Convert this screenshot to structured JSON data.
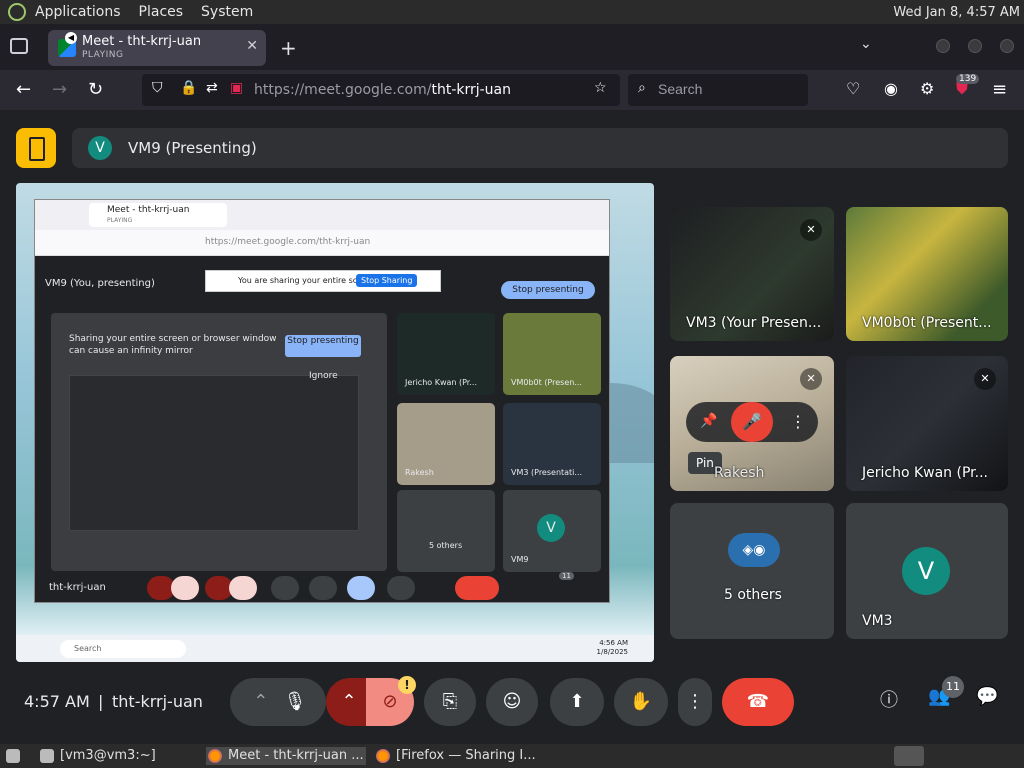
{
  "system_panel": {
    "menus": [
      "Applications",
      "Places",
      "System"
    ],
    "clock": "Wed Jan  8,  4:57 AM"
  },
  "browser": {
    "tab": {
      "title": "Meet - tht-krrj-uan",
      "status": "PLAYING"
    },
    "url": {
      "host": "https://meet.google.com/",
      "path": "tht-krrj-uan"
    },
    "search_placeholder": "Search",
    "extension_badge": "139"
  },
  "meet": {
    "presenting_bar": {
      "avatar_letter": "V",
      "text": "VM9 (Presenting)"
    },
    "shared_screen": {
      "inner_tab_title": "Meet - tht-krrj-uan",
      "inner_tab_status": "PLAYING",
      "inner_url": "https://meet.google.com/tht-krrj-uan",
      "share_banner": "You are sharing your entire screen.",
      "share_banner_button": "Stop Sharing",
      "presenting_header": "VM9 (You, presenting)",
      "stop_presenting": "Stop presenting",
      "infinity_message": "Sharing your entire screen or browser window can cause an infinity mirror",
      "stop_presenting_small": "Stop presenting",
      "ignore": "Ignore",
      "tiles": [
        "Jericho Kwan (Pr...",
        "VM0b0t (Presen...",
        "Rakesh",
        "VM3 (Presentati...",
        "5 others",
        "VM9"
      ],
      "vm9_letter": "V",
      "meeting_code": "tht-krrj-uan",
      "people_count": "11",
      "taskbar_search": "Search",
      "taskbar_time": "4:56 AM",
      "taskbar_date": "1/8/2025"
    },
    "tiles": {
      "vm3_presenting": "VM3 (Your Presen...",
      "vm0b0t": "VM0b0t (Present...",
      "rakesh": "Rakesh",
      "jericho": "Jericho Kwan (Pr...",
      "others": "5 others",
      "vm3": "VM3",
      "vm3_letter": "V",
      "pin_tooltip": "Pin"
    },
    "controls": {
      "time": "4:57 AM",
      "divider": "|",
      "meeting_code": "tht-krrj-uan",
      "people_count": "11",
      "warning": "!"
    }
  },
  "os_taskbar": {
    "items": [
      "[vm3@vm3:~]",
      "Meet - tht-krrj-uan ...",
      "[Firefox — Sharing I..."
    ]
  },
  "colors": {
    "meet_bg": "#202124",
    "tile_bg": "#3c4043",
    "end_call_red": "#ea4335",
    "avatar_teal": "#128c7e",
    "info_yellow": "#fbbc04"
  }
}
